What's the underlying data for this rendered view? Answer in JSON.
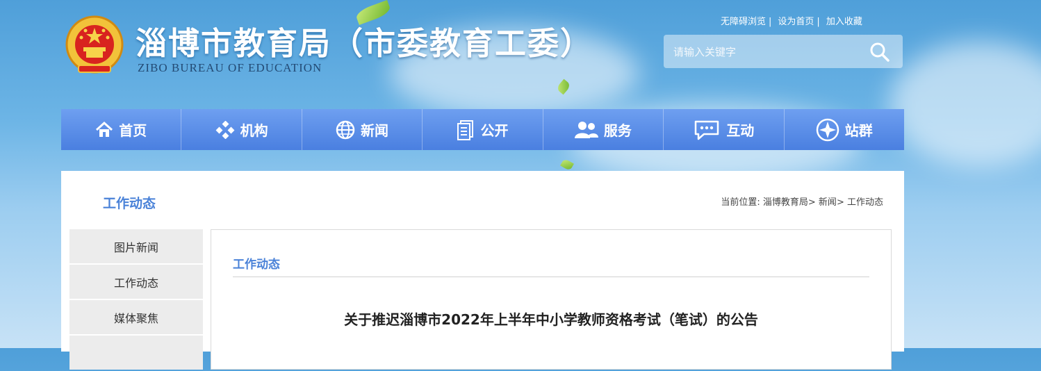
{
  "header": {
    "title": "淄博市教育局（市委教育工委）",
    "subtitle": "ZIBO BUREAU OF EDUCATION",
    "top_links": [
      "无障碍浏览",
      "设为首页",
      "加入收藏"
    ],
    "separator": "|"
  },
  "search": {
    "placeholder": "请输入关键字",
    "icon": "search-icon"
  },
  "nav": {
    "items": [
      {
        "label": "首页",
        "icon": "home-icon"
      },
      {
        "label": "机构",
        "icon": "structure-icon"
      },
      {
        "label": "新闻",
        "icon": "globe-icon"
      },
      {
        "label": "公开",
        "icon": "document-icon"
      },
      {
        "label": "服务",
        "icon": "users-icon"
      },
      {
        "label": "互动",
        "icon": "chat-icon"
      },
      {
        "label": "站群",
        "icon": "compass-icon"
      }
    ]
  },
  "section": {
    "title": "工作动态"
  },
  "breadcrumb": {
    "prefix": "当前位置:",
    "items": [
      "淄博教育局",
      "新闻",
      "工作动态"
    ],
    "separator": ">"
  },
  "sidebar": {
    "items": [
      "图片新闻",
      "工作动态",
      "媒体聚焦"
    ]
  },
  "content": {
    "heading": "工作动态",
    "article_title": "关于推迟淄博市2022年上半年中小学教师资格考试（笔试）的公告"
  },
  "colors": {
    "nav": "#5b8fe8",
    "accent": "#4a82d8",
    "sidebar": "#ececec"
  }
}
